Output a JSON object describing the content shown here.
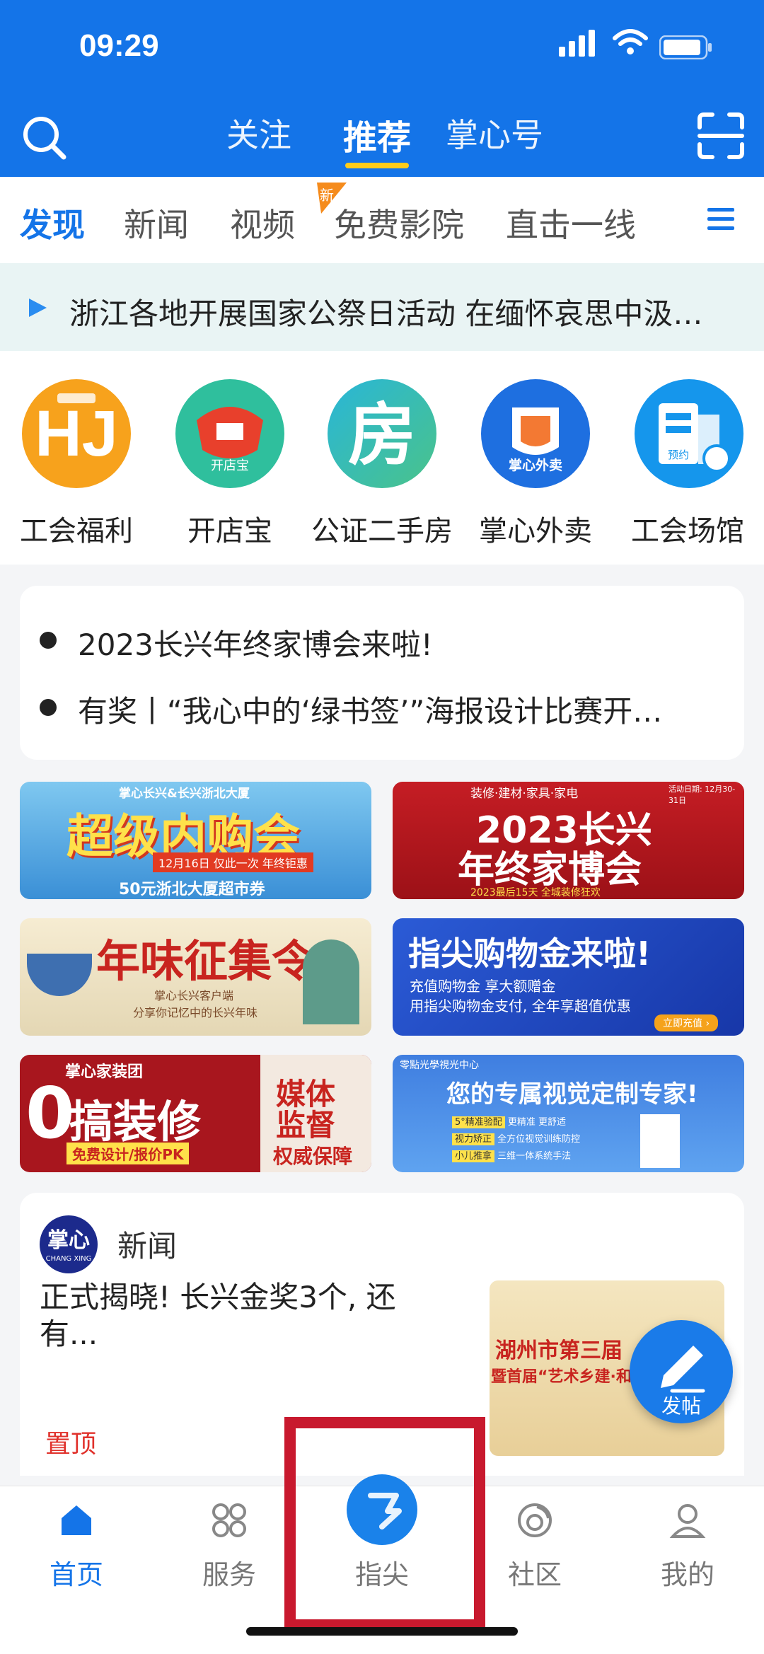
{
  "status_bar": {
    "time": "09:29"
  },
  "header": {
    "tabs": [
      {
        "label": "关注"
      },
      {
        "label": "推荐"
      },
      {
        "label": "掌心号"
      }
    ]
  },
  "channels": {
    "items": [
      "发现",
      "新闻",
      "视频",
      "免费影院",
      "直击一线"
    ],
    "new_badge": "新"
  },
  "ticker": {
    "text": "浙江各地开展国家公祭日活动 在缅怀哀思中汲…"
  },
  "services": [
    {
      "label": "工会福利",
      "icon": "union-benefit-icon",
      "color": "#f7a21c"
    },
    {
      "label": "开店宝",
      "icon": "shop-treasure-icon",
      "color": "#2fbf9d",
      "inner": "开店宝"
    },
    {
      "label": "公证二手房",
      "icon": "house-icon",
      "color": "#2fb4a0",
      "inner": "房"
    },
    {
      "label": "掌心外卖",
      "icon": "takeout-icon",
      "color": "#1e6fe0",
      "inner": "掌心外卖"
    },
    {
      "label": "工会场馆",
      "icon": "venue-booking-icon",
      "color": "#1596ec",
      "inner": "预约"
    }
  ],
  "headlines": [
    "2023长兴年终家博会来啦!",
    "有奖丨“我心中的‘绿书签’”海报设计比赛开…"
  ],
  "banners": [
    {
      "title": "超级内购会",
      "top": "掌心长兴&长兴浙北大厦",
      "sub": "12月16日 仅此一次 年终钜惠",
      "foot": "50元浙北大厦超市券"
    },
    {
      "title": "2023长兴",
      "title2": "年终家博会",
      "top": "装修·建材·家具·家电",
      "date": "活动日期: 12月30-31日",
      "foot": "2023最后15天 全城装修狂欢"
    },
    {
      "title": "年味征集令",
      "sub": "掌心长兴客户端",
      "sub2": "分享你记忆中的长兴年味"
    },
    {
      "title": "指尖购物金来啦!",
      "line1": "充值购物金  享大额赠金",
      "line2": "用指尖购物金支付, 全年享超值优惠",
      "btn": "立即充值 ›"
    },
    {
      "brand": "掌心家装团",
      "big0": "0",
      "big": "搞装修",
      "tag": "免费设计/报价PK",
      "right1": "媒体",
      "right2": "监督",
      "right3": "权威保障"
    },
    {
      "brand": "零點光學視光中心",
      "title": "您的专属视觉定制专家!",
      "r1": "5°精准验配",
      "r1b": "更精准 更舒适",
      "r2": "视力矫正",
      "r2b": "全方位视觉训练防控",
      "r3": "小儿推拿",
      "r3b": "三维一体系统手法"
    }
  ],
  "news": {
    "source": "新闻",
    "avatar_text": "掌心",
    "avatar_sub": "CHANG XING",
    "title": "正式揭晓! 长兴金奖3个, 还有...",
    "pin": "置顶",
    "thumb_title": "湖州市第三届",
    "thumb_sub": "暨首届“艺术乡建·和美",
    "post_label": "发帖"
  },
  "bottom_nav": [
    {
      "label": "首页",
      "active": true
    },
    {
      "label": "服务"
    },
    {
      "label": "指尖"
    },
    {
      "label": "社区"
    },
    {
      "label": "我的"
    }
  ],
  "colors": {
    "primary": "#1474e8",
    "highlight": "#c8192e",
    "accent": "#ffcc1a"
  }
}
